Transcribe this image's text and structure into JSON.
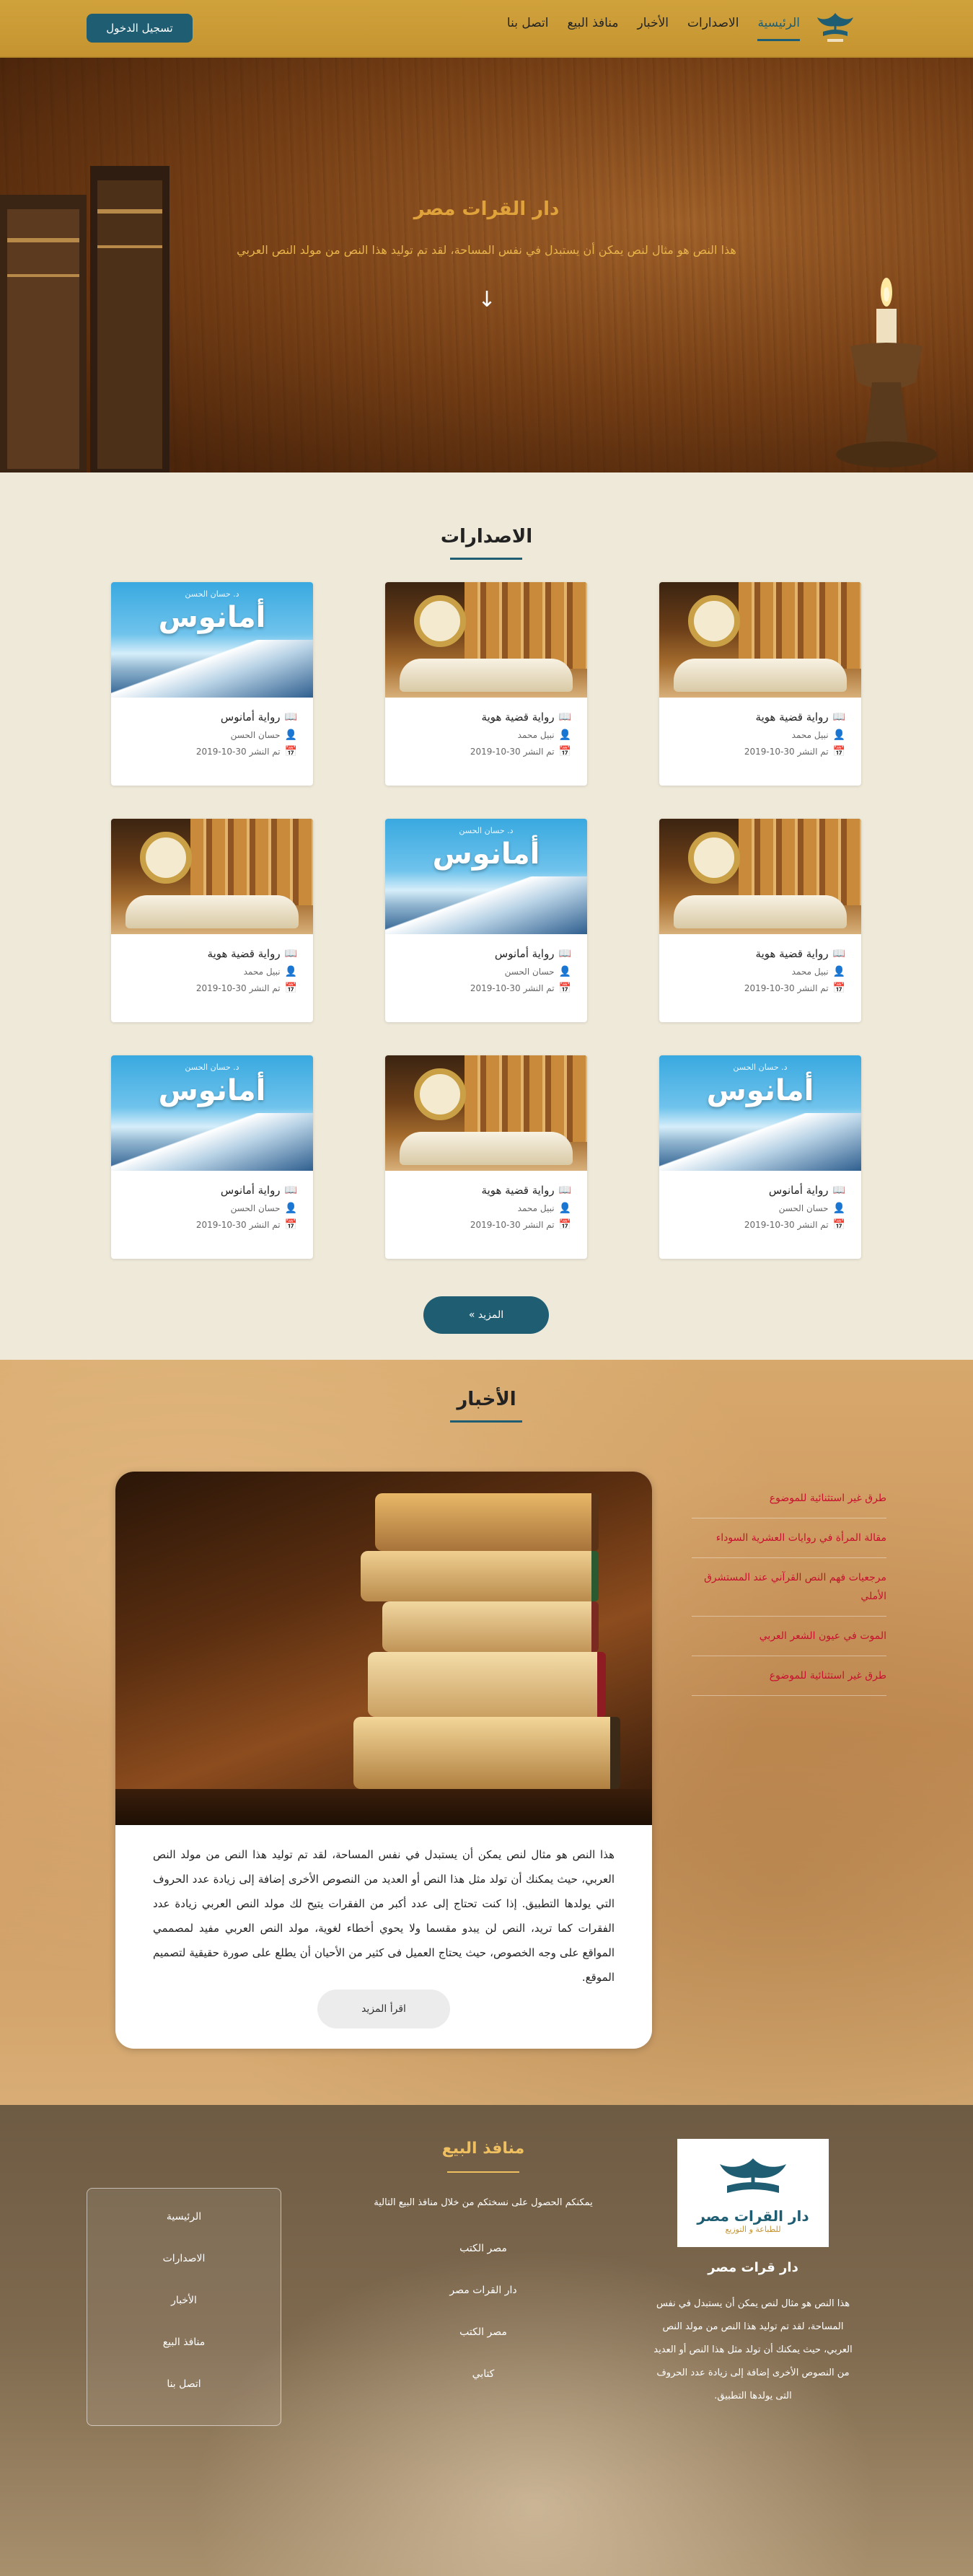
{
  "nav": {
    "items": [
      "الرئيسية",
      "الاصدارات",
      "الأخبار",
      "منافذ البيع",
      "اتصل بنا"
    ],
    "login_label": "تسجيل الدخول"
  },
  "hero": {
    "title": "دار القرات مصر",
    "subtitle": "هذا النص هو مثال لنص يمكن أن يستبدل في نفس المساحة، لقد تم توليد هذا النص من مولد النص العربي"
  },
  "releases": {
    "heading": "الاصدارات",
    "more_label": "المزيد »",
    "books": [
      {
        "title": "رواية قضية هوية",
        "author": "نبيل محمد",
        "date": "تم النشر 30-10-2019",
        "cover": "clock"
      },
      {
        "title": "رواية قضية هوية",
        "author": "نبيل محمد",
        "date": "تم النشر 30-10-2019",
        "cover": "clock"
      },
      {
        "title": "رواية أمانوس",
        "author": "حسان الحسن",
        "date": "تم النشر 30-10-2019",
        "cover": "snow"
      },
      {
        "title": "رواية قضية هوية",
        "author": "نبيل محمد",
        "date": "تم النشر 30-10-2019",
        "cover": "clock"
      },
      {
        "title": "رواية أمانوس",
        "author": "حسان الحسن",
        "date": "تم النشر 30-10-2019",
        "cover": "snow"
      },
      {
        "title": "رواية قضية هوية",
        "author": "نبيل محمد",
        "date": "تم النشر 30-10-2019",
        "cover": "clock"
      },
      {
        "title": "رواية أمانوس",
        "author": "حسان الحسن",
        "date": "تم النشر 30-10-2019",
        "cover": "snow"
      },
      {
        "title": "رواية قضية هوية",
        "author": "نبيل محمد",
        "date": "تم النشر 30-10-2019",
        "cover": "clock"
      },
      {
        "title": "رواية أمانوس",
        "author": "حسان الحسن",
        "date": "تم النشر 30-10-2019",
        "cover": "snow"
      }
    ],
    "cover_top_line": "د. حسان الحسن",
    "cover_big_title": "أمانوس"
  },
  "news": {
    "heading": "الأخبار",
    "body": "هذا النص هو مثال لنص يمكن أن يستبدل في نفس المساحة، لقد تم توليد هذا النص من مولد النص العربي، حيث يمكنك أن تولد مثل هذا النص أو العديد من النصوص الأخرى إضافة إلى زيادة عدد الحروف التي يولدها التطبيق. إذا كنت تحتاج إلى عدد أكبر من الفقرات يتيح لك مولد النص العربي زيادة عدد الفقرات كما تريد، النص لن يبدو مقسما ولا يحوي أخطاء لغوية، مولد النص العربي مفيد لمصممي المواقع على وجه الخصوص، حيث يحتاج العميل فى كثير من الأحيان أن يطلع على صورة حقيقية لتصميم الموقع.",
    "read_more_label": "اقرأ المزيد",
    "links": [
      "طرق غير استثنائية للموضوع",
      "مقالة المرأة في روايات العشرية السوداء",
      "مرجعيات فهم النص القرآني عند المستشرق الأملي",
      "الموت في عيون الشعر العربي",
      "طرق غير استثنائية للموضوع"
    ]
  },
  "footer": {
    "logo_name": "دار القرات مصر",
    "logo_tag": "للطباعة و التوزيع",
    "brand": "دار قرات مصر",
    "about": "هذا النص هو مثال لنص يمكن أن يستبدل في نفس المساحة، لقد تم توليد هذا النص من مولد النص العربي، حيث يمكنك أن تولد مثل هذا النص أو العديد من النصوص الأخرى إضافة إلى زيادة عدد الحروف التى يولدها التطبيق.",
    "sales_title": "منافذ البيع",
    "sales_intro": "يمكنكم الحصول على نسختكم من خلال منافذ البيع التالية",
    "sales": [
      "مصر الكتب",
      "دار القرات مصر",
      "مصر الكتب",
      "كتابي"
    ],
    "menu": [
      "الرئيسية",
      "الاصدارات",
      "الأخبار",
      "منافذ البيع",
      "اتصل بنا"
    ]
  },
  "colors": {
    "brand_gold": "#c59430",
    "brand_teal": "#1f5d73",
    "news_link_red": "#c8102e"
  }
}
